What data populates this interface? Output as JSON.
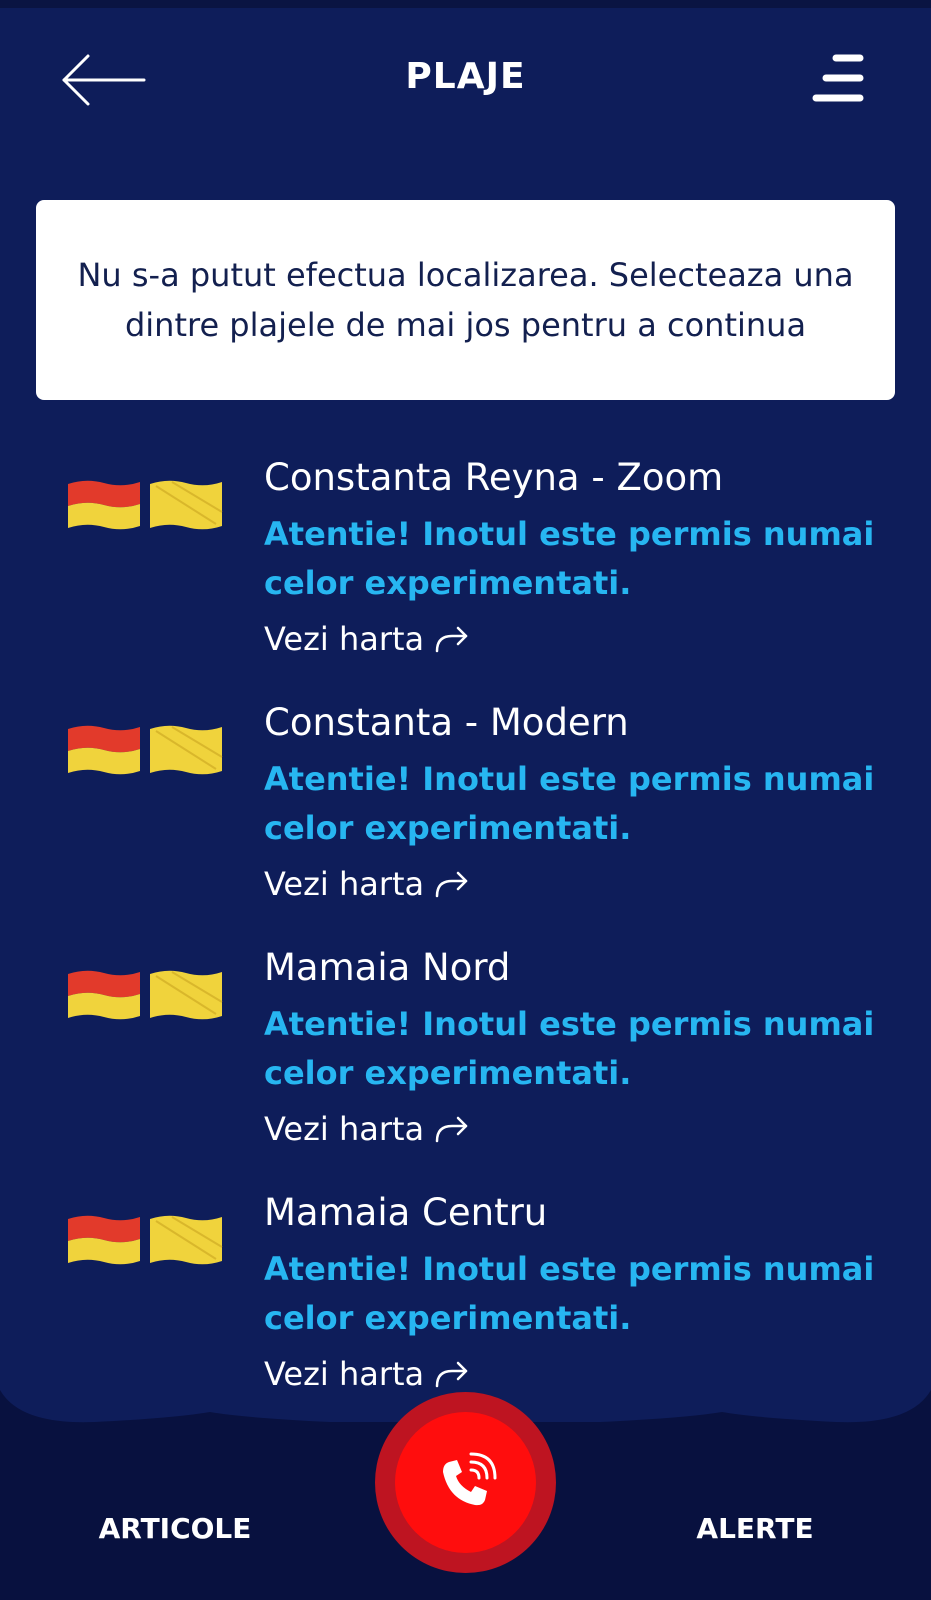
{
  "header": {
    "title": "PLAJE",
    "back_icon": "arrow-left-icon",
    "menu_icon": "hamburger-menu-icon"
  },
  "notice": {
    "text": "Nu s-a putut efectua localizarea. Selecteaza una dintre plajele de mai jos pentru a continua"
  },
  "beaches": [
    {
      "name": "Constanta Reyna - Zoom",
      "warning": "Atentie! Inotul este permis numai celor experimentati.",
      "map_link": "Vezi harta"
    },
    {
      "name": "Constanta - Modern",
      "warning": "Atentie! Inotul este permis numai celor experimentati.",
      "map_link": "Vezi harta"
    },
    {
      "name": "Mamaia Nord",
      "warning": "Atentie! Inotul este permis numai celor experimentati.",
      "map_link": "Vezi harta"
    },
    {
      "name": "Mamaia Centru",
      "warning": "Atentie! Inotul este permis numai celor experimentati.",
      "map_link": "Vezi harta"
    }
  ],
  "bottom_nav": {
    "articole": "ARTICOLE",
    "alerte": "ALERTE",
    "call_icon": "phone-call-icon"
  },
  "colors": {
    "background": "#0e1d5a",
    "bottom_bar": "#08113f",
    "warning_text": "#27b6f1",
    "emergency_outer": "#be1421",
    "emergency_inner": "#ff0d0d",
    "flag_red": "#e23a2b",
    "flag_yellow": "#f0d33c"
  }
}
